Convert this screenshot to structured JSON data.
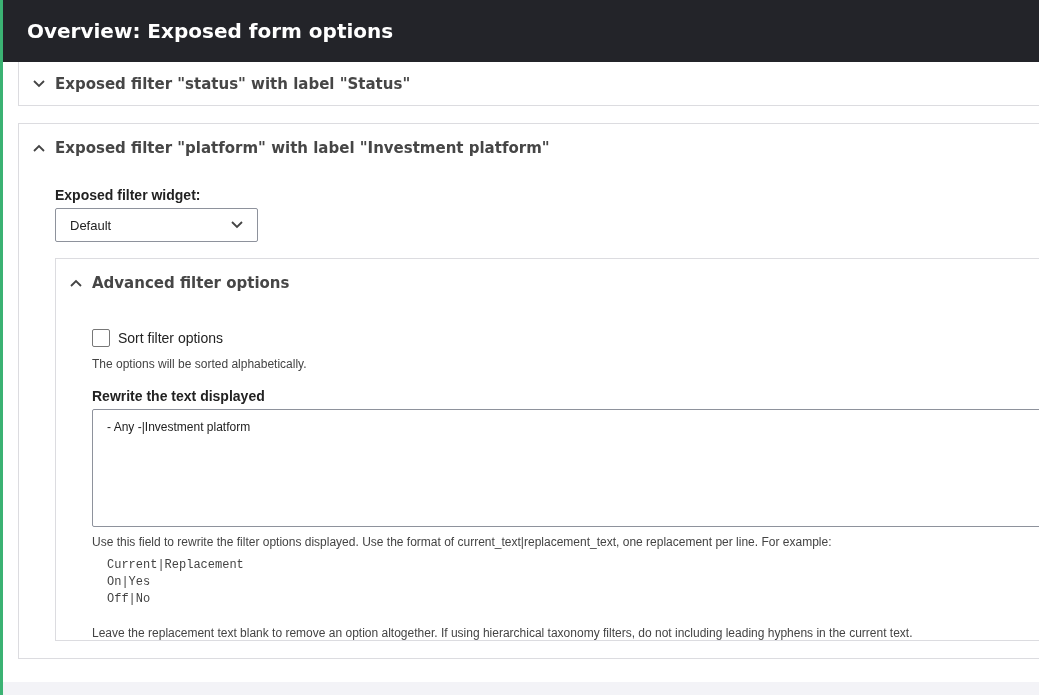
{
  "dialog": {
    "title": "Overview: Exposed form options"
  },
  "sections": [
    {
      "title": "Exposed filter \"status\" with label \"Status\"",
      "expanded": false
    },
    {
      "title": "Exposed filter \"platform\" with label \"Investment platform\"",
      "expanded": true,
      "widget": {
        "label": "Exposed filter widget:",
        "value": "Default"
      },
      "advanced": {
        "title": "Advanced filter options",
        "expanded": true,
        "checkbox": {
          "label": "Sort filter options",
          "checked": false,
          "description": "The options will be sorted alphabetically."
        },
        "rewrite": {
          "label": "Rewrite the text displayed",
          "value": "- Any -|Investment platform",
          "description": "Use this field to rewrite the filter options displayed. Use the format of current_text|replacement_text, one replacement per line. For example:",
          "examples": [
            "Current|Replacement",
            "On|Yes",
            "Off|No"
          ],
          "note": "Leave the replacement text blank to remove an option altogether. If using hierarchical taxonomy filters, do not including leading hyphens in the current text."
        }
      }
    }
  ]
}
